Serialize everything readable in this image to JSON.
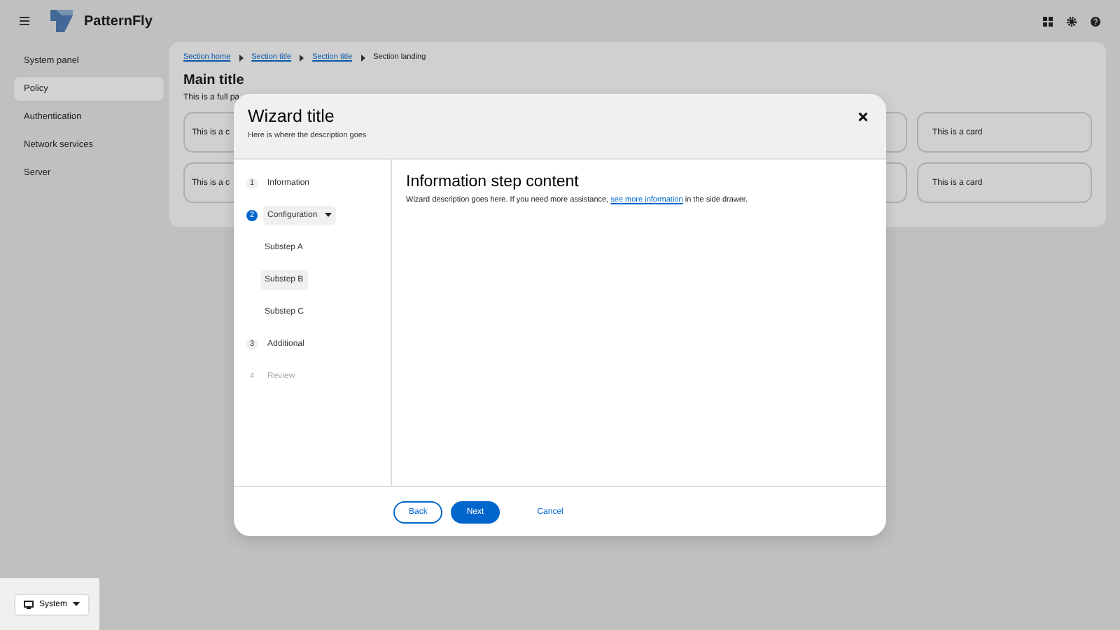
{
  "masthead": {
    "brand": "PatternFly"
  },
  "sidebar": {
    "items": [
      {
        "label": "System panel",
        "selected": false
      },
      {
        "label": "Policy",
        "selected": true
      },
      {
        "label": "Authentication",
        "selected": false
      },
      {
        "label": "Network services",
        "selected": false
      },
      {
        "label": "Server",
        "selected": false
      }
    ]
  },
  "breadcrumb": [
    {
      "label": "Section home",
      "kind": "link"
    },
    {
      "label": "Section title",
      "kind": "link"
    },
    {
      "label": "Section title",
      "kind": "link"
    },
    {
      "label": "Section landing",
      "kind": "current"
    }
  ],
  "page": {
    "title": "Main title",
    "description": "This is a full pa"
  },
  "card_rows": [
    {
      "first": "This is a c",
      "last": "This is a card"
    },
    {
      "first": "This is a c",
      "last": "This is a card"
    }
  ],
  "theme_selector": {
    "label": "System"
  },
  "wizard": {
    "title": "Wizard title",
    "description": "Here is where the description goes",
    "steps": [
      {
        "number": "1",
        "label": "Information",
        "selected": false,
        "disabled": false
      },
      {
        "number": "2",
        "label": "Configuration",
        "selected": true,
        "disabled": false,
        "expanded": true,
        "children": [
          {
            "label": "Substep A",
            "selected": false
          },
          {
            "label": "Substep B",
            "selected": true
          },
          {
            "label": "Substep C",
            "selected": false
          }
        ]
      },
      {
        "number": "3",
        "label": "Additional",
        "selected": false,
        "disabled": false
      },
      {
        "number": "4",
        "label": "Review",
        "selected": false,
        "disabled": true
      }
    ],
    "content": {
      "title": "Information step content",
      "before": "Wizard description goes here. If you need more assistance, ",
      "link": "see more information",
      "after": " in the side drawer."
    },
    "buttons": [
      {
        "label": "Back",
        "kind": "secondary"
      },
      {
        "label": "Next",
        "kind": "primary"
      },
      {
        "label": "Cancel",
        "kind": "link"
      }
    ]
  }
}
